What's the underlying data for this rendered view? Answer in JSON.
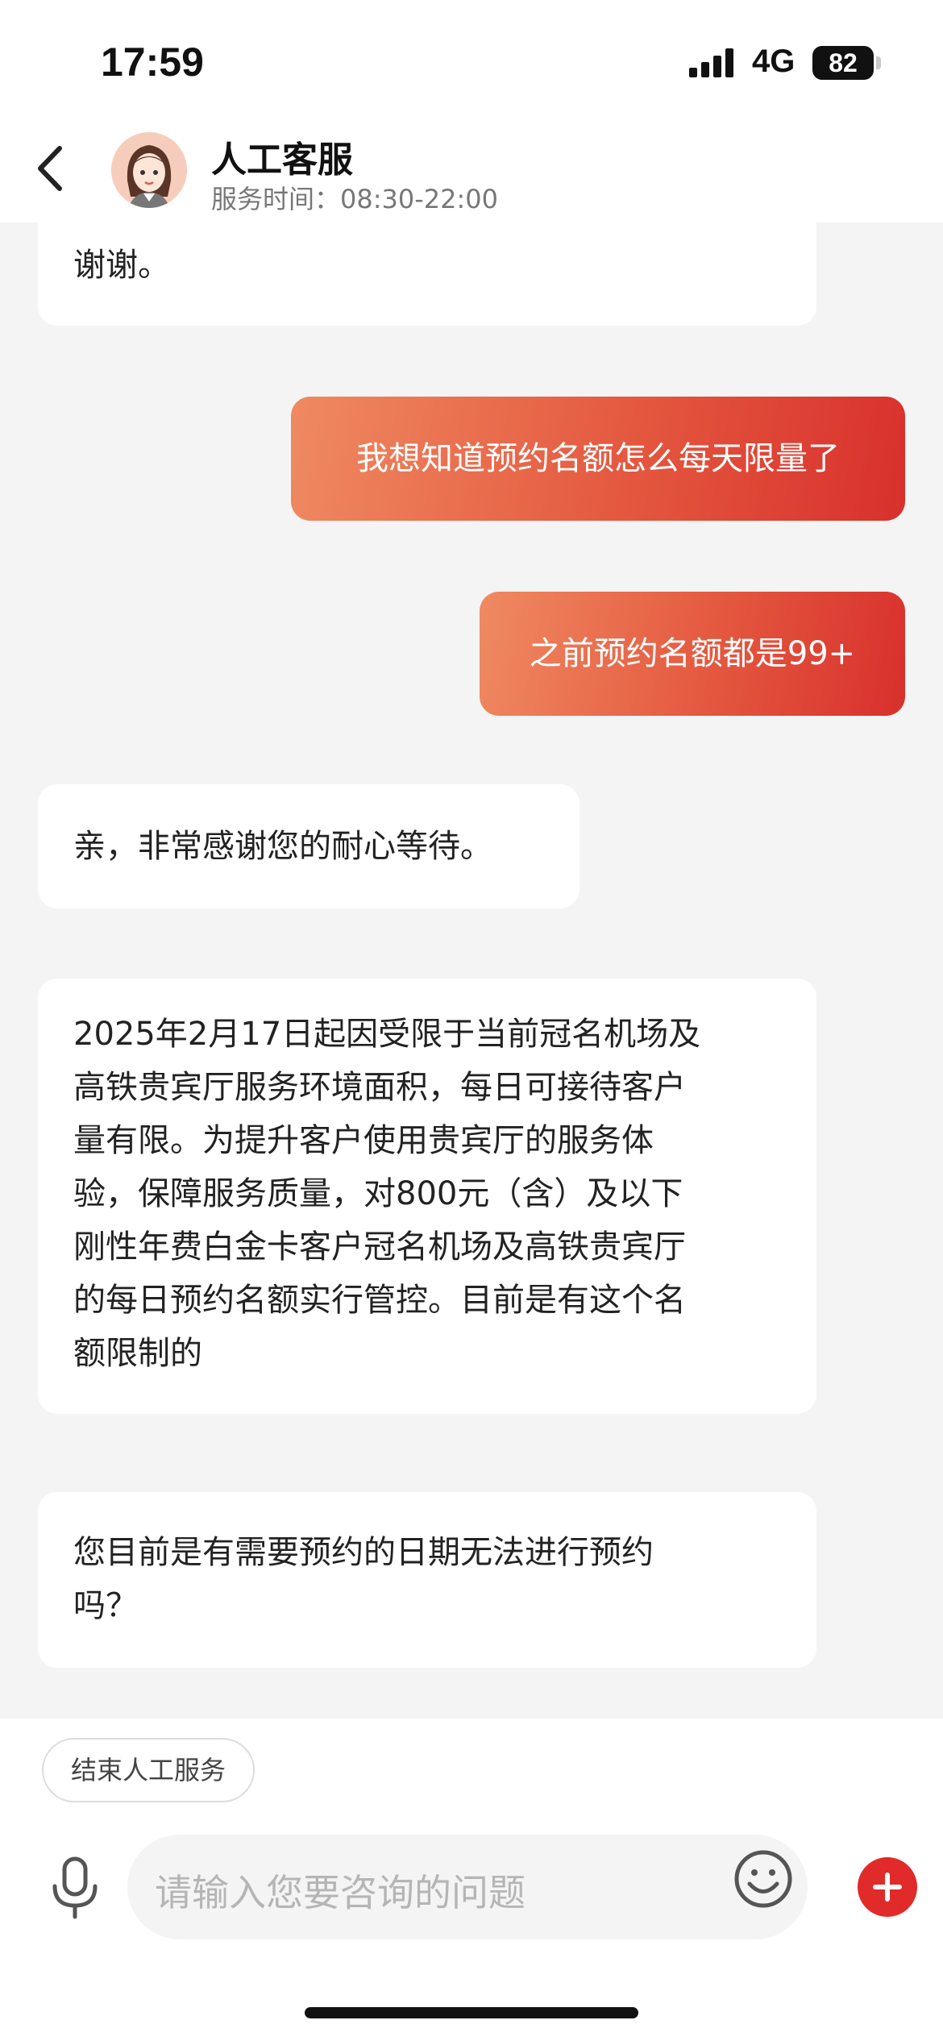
{
  "status_bar": {
    "time": "17:59",
    "network": "4G",
    "battery": "82"
  },
  "header": {
    "title": "人工客服",
    "service_hours": "服务时间：08:30-22:00"
  },
  "messages": [
    {
      "sender": "agent",
      "text": "谢谢。"
    },
    {
      "sender": "user",
      "text": "我想知道预约名额怎么每天限量了"
    },
    {
      "sender": "user",
      "text": "之前预约名额都是99+"
    },
    {
      "sender": "agent",
      "text": "亲，非常感谢您的耐心等待。"
    },
    {
      "sender": "agent",
      "lines": [
        "2025年2月17日起因受限于当前冠名机场及",
        "高铁贵宾厅服务环境面积，每日可接待客户",
        "量有限。为提升客户使用贵宾厅的服务体",
        "验，保障服务质量，对800元（含）及以下",
        "刚性年费白金卡客户冠名机场及高铁贵宾厅",
        "的每日预约名额实行管控。目前是有这个名",
        "额限制的"
      ]
    },
    {
      "sender": "agent",
      "lines": [
        "您目前是有需要预约的日期无法进行预约",
        "吗？"
      ]
    }
  ],
  "bottom": {
    "end_service_label": "结束人工服务",
    "input_placeholder": "请输入您要咨询的问题"
  },
  "colors": {
    "accent": "#e12a2a",
    "user_bubble_start": "#ef8a62",
    "user_bubble_end": "#d8302c"
  },
  "icons": [
    "back-icon",
    "avatar",
    "microphone-icon",
    "emoji-icon",
    "plus-icon",
    "signal-icon",
    "battery-icon"
  ]
}
